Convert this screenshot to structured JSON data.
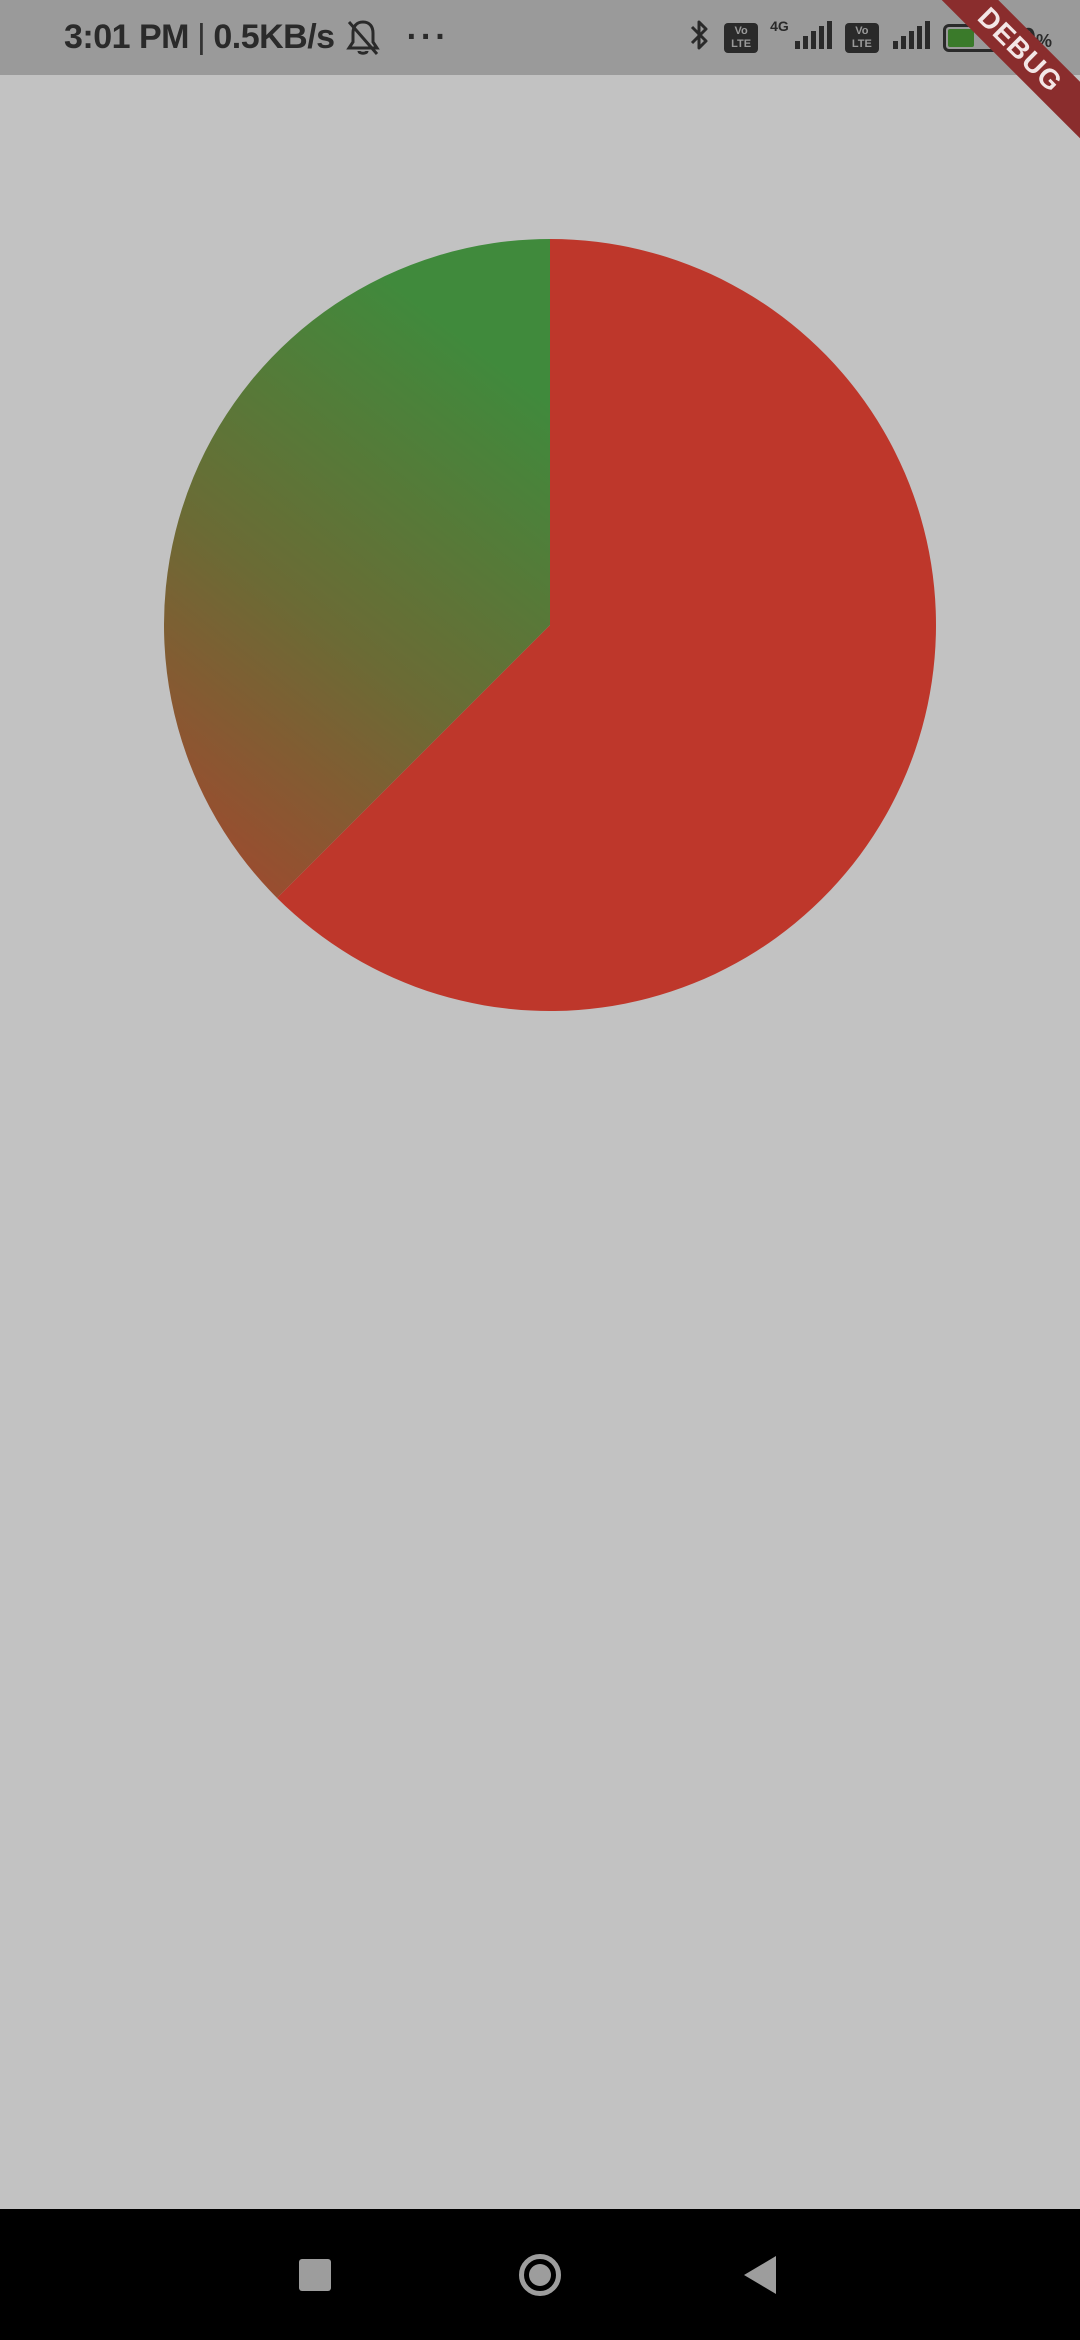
{
  "status_bar": {
    "time": "3:01 PM",
    "separator": "|",
    "network_speed": "0.5KB/s",
    "more": "···",
    "icons": [
      "bell-off-icon",
      "bluetooth-icon",
      "volte-icon",
      "signal-icon",
      "volte-icon",
      "signal-icon",
      "battery-icon"
    ],
    "volte_label_1": "Vo",
    "volte_label_2": "LTE",
    "network_type": "4G",
    "battery_percent": "60",
    "battery_unit": "%",
    "battery_level": 0.6
  },
  "debug_banner": {
    "label": "DEBUG"
  },
  "chart_data": {
    "type": "pie",
    "slices": [
      {
        "fraction": 0.625,
        "color": "#be372b"
      },
      {
        "fraction": 0.375,
        "gradient_from": "#a6452e",
        "gradient_to": "#408a3c"
      }
    ],
    "colors": {
      "red": "#be372b",
      "green": "#408a3c",
      "olive": "#6b6b35"
    }
  },
  "nav_bar": {
    "buttons": [
      "recents-button",
      "home-button",
      "back-button"
    ]
  }
}
